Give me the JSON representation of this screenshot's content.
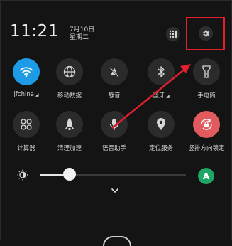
{
  "status": {
    "time": "11:21",
    "date_line1": "7月10日",
    "date_line2": "星期二"
  },
  "tiles_row1": [
    {
      "label": "jfchina",
      "icon": "wifi-icon",
      "active": true
    },
    {
      "label": "移动数据",
      "icon": "globe-icon",
      "active": false
    },
    {
      "label": "静音",
      "icon": "mute-icon",
      "active": false
    },
    {
      "label": "蓝牙",
      "icon": "bluetooth-icon",
      "active": false
    },
    {
      "label": "手电筒",
      "icon": "flashlight-icon",
      "active": false
    }
  ],
  "tiles_row2": [
    {
      "label": "计算器",
      "icon": "calculator-icon",
      "active": false
    },
    {
      "label": "清理加速",
      "icon": "rocket-icon",
      "active": false
    },
    {
      "label": "语音助手",
      "icon": "microphone-icon",
      "active": false
    },
    {
      "label": "定位服务",
      "icon": "location-icon",
      "active": false
    },
    {
      "label": "竖排方向锁定",
      "icon": "rotation-lock-icon",
      "active": true
    }
  ],
  "brightness": {
    "level": 0.2,
    "auto_label": "A"
  },
  "colors": {
    "wifi_active": "#1e9be6",
    "rotation_lock_active": "#e05a5e",
    "auto_brightness": "#1fa565",
    "annotation_red": "#e0202c"
  }
}
